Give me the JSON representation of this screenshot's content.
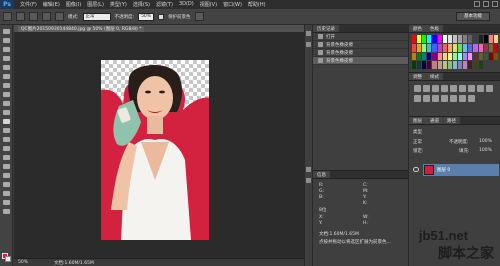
{
  "app": {
    "logo": "Ps"
  },
  "menu": [
    "文件(F)",
    "编辑(E)",
    "图像(I)",
    "图层(L)",
    "类型(Y)",
    "选择(S)",
    "滤镜(T)",
    "3D(D)",
    "视图(V)",
    "窗口(W)",
    "帮助(H)"
  ],
  "options": {
    "mode_label": "模式:",
    "mode_value": "正常",
    "opacity_label": "不透明度:",
    "opacity_value": "50%",
    "protect_label": "保护前景色",
    "workspace": "基本功能"
  },
  "document": {
    "tab": "QC图片20150930144840.jpg @ 50% (图层 0, RGB/8) *",
    "zoom": "50%",
    "status": "文档:1.60M/1.65M"
  },
  "history": {
    "tabs": [
      "历史记录"
    ],
    "rows": [
      "打开",
      "背景色橡皮擦",
      "背景色橡皮擦",
      "背景色橡皮擦"
    ]
  },
  "info": {
    "tab": "信息",
    "lines": [
      "R:",
      "G:",
      "B:",
      "C:",
      "M:",
      "Y:",
      "K:",
      "X:",
      "Y:",
      "W:",
      "H:",
      "8位"
    ],
    "doc": "文档:1.60M/1.65M",
    "hint": "点按并拖动以将选区扩展为前景色..."
  },
  "swatches_panel": {
    "tabs": [
      "颜色",
      "色板"
    ],
    "colors": [
      "#ff0000",
      "#ffff00",
      "#00ff00",
      "#00ffff",
      "#0000ff",
      "#ff00ff",
      "#ffffff",
      "#e0e0e0",
      "#c0c0c0",
      "#a0a0a0",
      "#808080",
      "#606060",
      "#404040",
      "#202020",
      "#000000",
      "#ff8080",
      "#ffd080",
      "#ff4040",
      "#ffa000",
      "#80ff80",
      "#40c0c0",
      "#4060ff",
      "#c040c0",
      "#ff6060",
      "#ffb060",
      "#e0e060",
      "#60e060",
      "#60c0e0",
      "#6060ff",
      "#c060ff",
      "#ff60c0",
      "#804040",
      "#806040",
      "#c00000",
      "#c08000",
      "#008000",
      "#008080",
      "#000080",
      "#800080",
      "#ff9090",
      "#ffcc90",
      "#ffff90",
      "#90ff90",
      "#90ffff",
      "#9090ff",
      "#ff90ff",
      "#603030",
      "#606030",
      "#306030",
      "#800000",
      "#805000",
      "#004000",
      "#004040",
      "#000040",
      "#400040",
      "#c08080",
      "#c0a080",
      "#c0c080",
      "#80c080",
      "#80c0c0",
      "#8080c0",
      "#c080c0",
      "#402020",
      "#404020",
      "#204020"
    ]
  },
  "adjustments": {
    "tabs": [
      "调整",
      "样式"
    ],
    "title": "添加调整"
  },
  "layers": {
    "tabs": [
      "图层",
      "通道",
      "路径"
    ],
    "kind_label": "类型",
    "blend": "正常",
    "opacity_label": "不透明度:",
    "opacity": "100%",
    "lock_label": "锁定:",
    "fill_label": "填充:",
    "fill": "100%",
    "layer_name": "图层 0"
  },
  "watermark": {
    "url": "jb51.net",
    "cn": "脚本之家"
  }
}
